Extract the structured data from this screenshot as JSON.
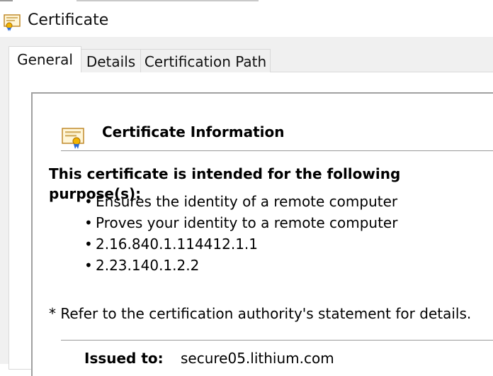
{
  "window": {
    "title": "Certificate",
    "icon": "certificate-icon"
  },
  "tabs": [
    {
      "label": "General",
      "active": true
    },
    {
      "label": "Details",
      "active": false
    },
    {
      "label": "Certification Path",
      "active": false
    }
  ],
  "info": {
    "title": "Certificate Information",
    "icon": "certificate-icon",
    "purpose_heading": "This certificate is intended for the following purpose(s):",
    "bullet": "•",
    "purposes": [
      "Ensures the identity of a remote computer",
      "Proves your identity to a remote computer",
      "2.16.840.1.114412.1.1",
      "2.23.140.1.2.2"
    ],
    "note": "* Refer to the certification authority's statement for details.",
    "issued_to_label": "Issued to:",
    "issued_to_value": "secure05.lithium.com"
  }
}
